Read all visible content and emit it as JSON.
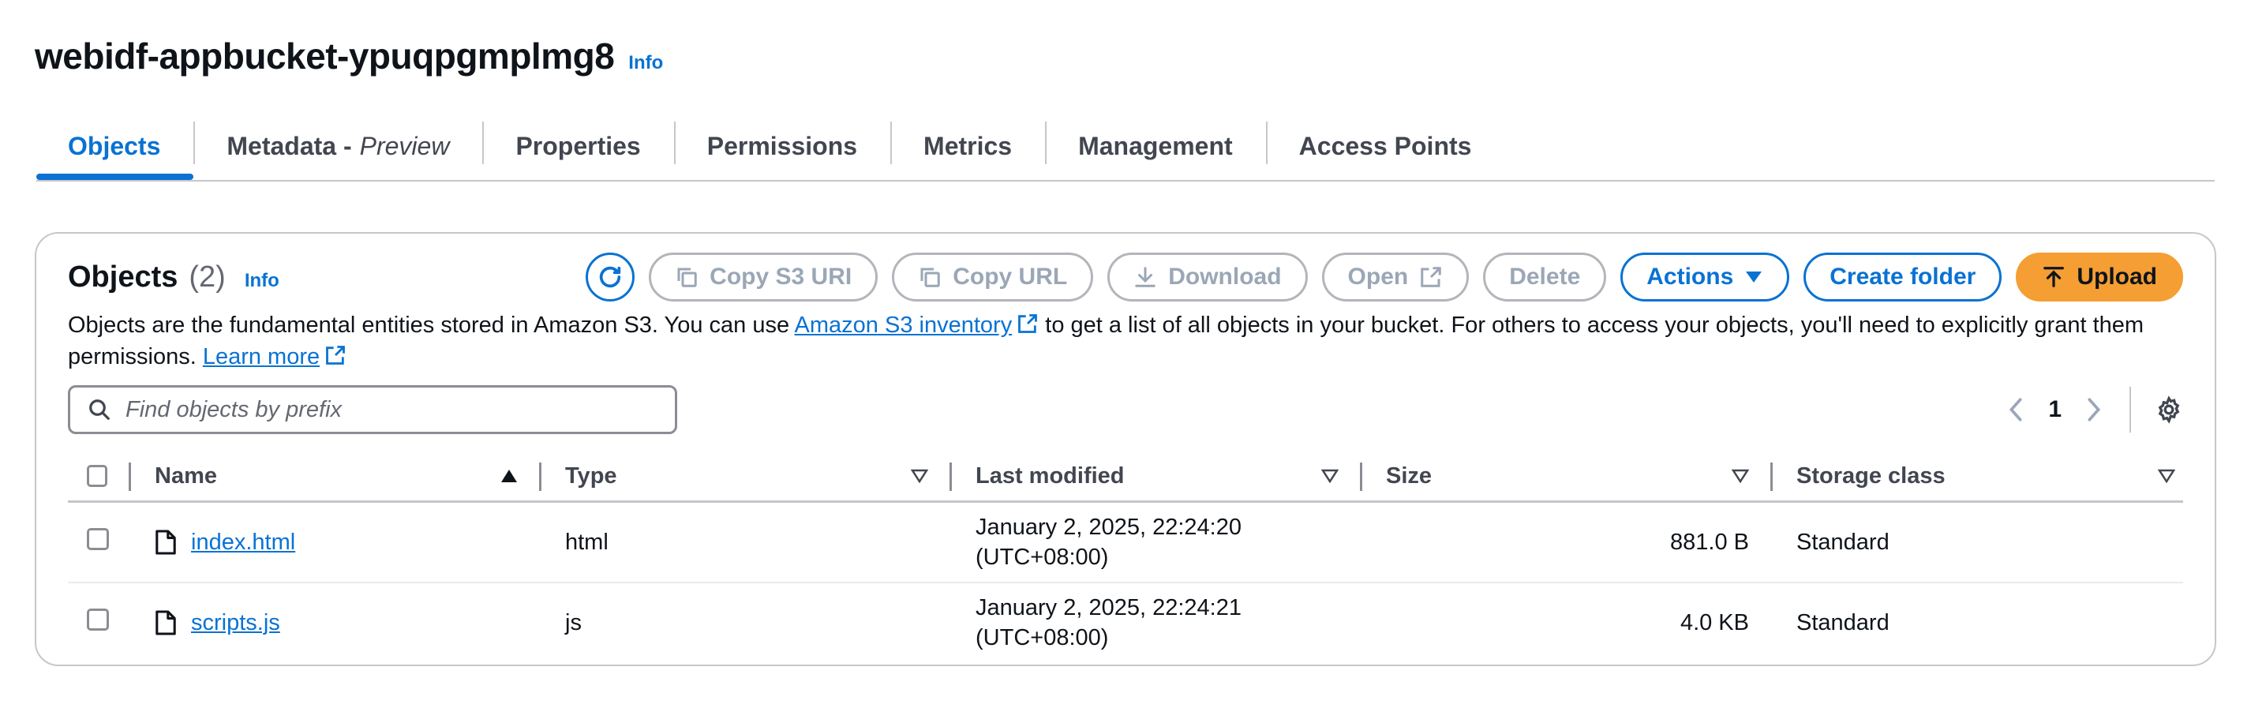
{
  "bucket": {
    "name": "webidf-appbucket-ypuqpgmplmg8",
    "info": "Info"
  },
  "tabs": [
    {
      "label": "Objects",
      "suffix": ""
    },
    {
      "label": "Metadata -",
      "suffix": "Preview"
    },
    {
      "label": "Properties",
      "suffix": ""
    },
    {
      "label": "Permissions",
      "suffix": ""
    },
    {
      "label": "Metrics",
      "suffix": ""
    },
    {
      "label": "Management",
      "suffix": ""
    },
    {
      "label": "Access Points",
      "suffix": ""
    }
  ],
  "objects_panel": {
    "title": "Objects",
    "count": "(2)",
    "info": "Info",
    "description_pre": "Objects are the fundamental entities stored in Amazon S3. You can use ",
    "description_link": "Amazon S3 inventory",
    "description_mid": " to get a list of all objects in your bucket. For others to access your objects, you'll need to explicitly grant them permissions. ",
    "learn_more": "Learn more"
  },
  "toolbar": {
    "refresh_icon": "refresh-icon",
    "copy_s3_uri": "Copy S3 URI",
    "copy_url": "Copy URL",
    "download": "Download",
    "open": "Open",
    "delete": "Delete",
    "actions": "Actions",
    "create_folder": "Create folder",
    "upload": "Upload"
  },
  "search": {
    "placeholder": "Find objects by prefix",
    "value": ""
  },
  "pagination": {
    "page": "1"
  },
  "table": {
    "columns": [
      "Name",
      "Type",
      "Last modified",
      "Size",
      "Storage class"
    ],
    "rows": [
      {
        "name": "index.html",
        "type": "html",
        "modified_date": "January 2, 2025, 22:24:20",
        "modified_tz": "(UTC+08:00)",
        "size": "881.0 B",
        "storage_class": "Standard"
      },
      {
        "name": "scripts.js",
        "type": "js",
        "modified_date": "January 2, 2025, 22:24:21",
        "modified_tz": "(UTC+08:00)",
        "size": "4.0 KB",
        "storage_class": "Standard"
      }
    ]
  },
  "colors": {
    "accent": "#0972d3",
    "primary_button": "#f59e34",
    "disabled": "#9ba7b6",
    "border": "#c6c6cd"
  }
}
